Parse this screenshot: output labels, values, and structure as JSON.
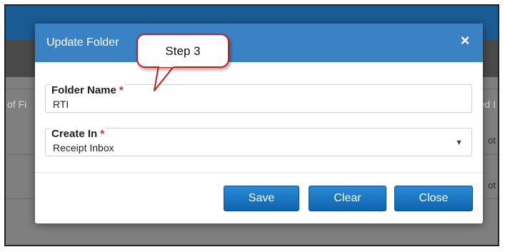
{
  "background": {
    "col_left": "of Fi",
    "col_right": "ed I",
    "row1_text": "ot",
    "row2_text": "ot"
  },
  "modal": {
    "title": "Update Folder",
    "close_icon": "×",
    "folder_name": {
      "label": "Folder Name",
      "required_mark": "*",
      "value": "RTI"
    },
    "create_in": {
      "label": "Create In",
      "required_mark": "*",
      "value": "Receipt Inbox",
      "caret": "▼"
    },
    "buttons": {
      "save": "Save",
      "clear": "Clear",
      "close": "Close"
    }
  },
  "callout": {
    "text": "Step 3"
  },
  "colors": {
    "header": "#3b82c4",
    "button": "#1a74c2",
    "required": "#d62626",
    "callout_border": "#c81e1e"
  }
}
